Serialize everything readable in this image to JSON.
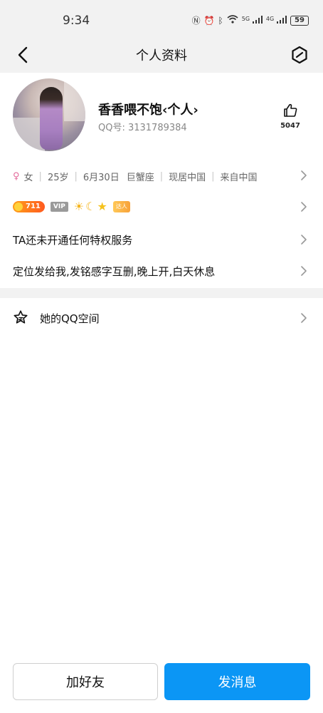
{
  "status_bar": {
    "time": "9:34",
    "icons": [
      "nfc-icon",
      "alarm-icon",
      "bluetooth-icon",
      "wifi-icon",
      "signal-5g-icon",
      "signal-4g-icon"
    ],
    "signal_5g": "5G",
    "signal_4g": "4G",
    "battery": "59"
  },
  "nav": {
    "title": "个人资料"
  },
  "profile": {
    "nickname": "香香喂不饱‹个人›",
    "qq_label": "QQ号: 3131789384",
    "like_count": "5047"
  },
  "info": {
    "gender": "女",
    "age": "25岁",
    "birthday": "6月30日",
    "zodiac": "巨蟹座",
    "location": "现居中国",
    "hometown": "来自中国"
  },
  "badges": {
    "level": "711",
    "vip": "VIP",
    "extra": "达人"
  },
  "privilege_text": "TA还未开通任何特权服务",
  "signature_text": "定位发给我,发铭感字互删,晚上开,白天休息",
  "qzone_label": "她的QQ空间",
  "buttons": {
    "add_friend": "加好友",
    "send_message": "发消息"
  },
  "colors": {
    "accent": "#0b96f5",
    "band": "#f2f2f2",
    "gender": "#e36a9b"
  }
}
